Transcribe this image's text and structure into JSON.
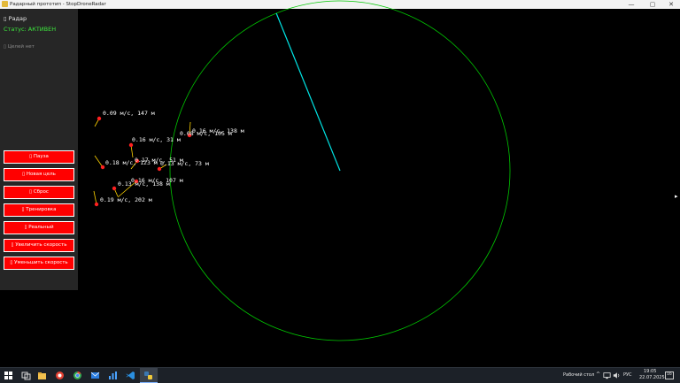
{
  "window": {
    "title": "Радарный прототип - StopDroneRadar",
    "minimize": "—",
    "maximize": "▢",
    "close": "✕"
  },
  "sidebar": {
    "title": "▯ Радар",
    "status": "Статус: АКТИВЕН",
    "targets_info": "▯ Целей нет",
    "buttons": [
      {
        "label": "▯ Пауза"
      },
      {
        "label": "▯ Новая цель"
      },
      {
        "label": "▯ Сброс"
      },
      {
        "label": "▯ Тренировка"
      },
      {
        "label": "▯ Реальный"
      },
      {
        "label": "▯ Увеличить скорость"
      },
      {
        "label": "▯ Уменьшить скорость"
      }
    ]
  },
  "radar": {
    "circle_color": "#00c800",
    "sweep_color": "#00e5e5",
    "sweep_bearing_deg": -22,
    "target_color": "#ff2020",
    "vector_color": "#ffd400",
    "label_color": "#ffffff"
  },
  "targets": [
    {
      "label": "0.09 м/с, 147 м"
    },
    {
      "label": "0.16 м/с, 138 м"
    },
    {
      "label": "0.08 м/с, 105 м"
    },
    {
      "label": "0.16 м/с, 31 м"
    },
    {
      "label": "0.17 м/с, 51 м"
    },
    {
      "label": "0.18 м/с, 123 м"
    },
    {
      "label": "0.13 м/с, 73 м"
    },
    {
      "label": "0.16 м/с, 107 м"
    },
    {
      "label": "0.13 м/с, 138 м"
    },
    {
      "label": "0.19 м/с, 202 м"
    }
  ],
  "taskbar": {
    "desktop_label": "Рабочий стол",
    "lang": "РУС",
    "time": "19:05",
    "date": "22.07.2025",
    "notification_count": "16"
  },
  "side_arrow": "▸"
}
